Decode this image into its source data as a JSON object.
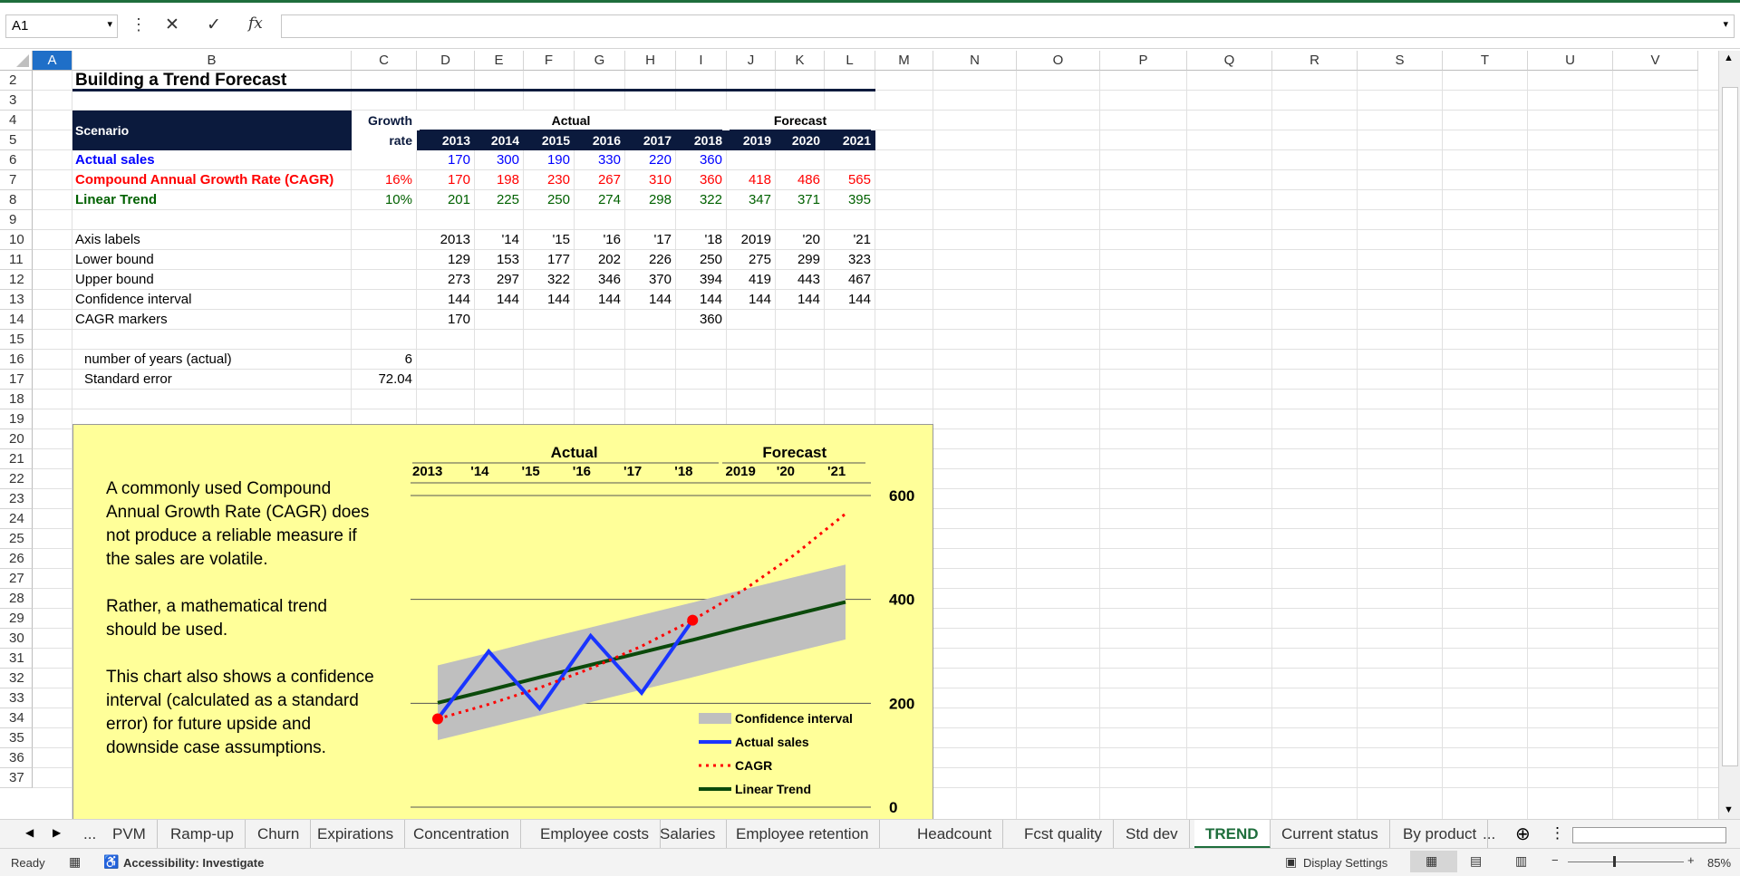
{
  "formula_bar": {
    "name_box": "A1",
    "formula": ""
  },
  "columns": [
    "A",
    "B",
    "C",
    "D",
    "E",
    "F",
    "G",
    "H",
    "I",
    "J",
    "K",
    "L",
    "M",
    "N",
    "O",
    "P",
    "Q",
    "R",
    "S",
    "T",
    "U",
    "V"
  ],
  "rows": [
    "2",
    "3",
    "4",
    "5",
    "6",
    "7",
    "8",
    "9",
    "10",
    "11",
    "12",
    "13",
    "14",
    "15",
    "16",
    "17",
    "18",
    "19",
    "20",
    "21",
    "22",
    "23",
    "24",
    "25",
    "26",
    "27",
    "28",
    "29",
    "30",
    "31",
    "32",
    "33",
    "34",
    "35",
    "36",
    "37"
  ],
  "sheet": {
    "title": "Building a Trend Forecast",
    "header": {
      "scenario": "Scenario",
      "growth_rate_1": "Growth",
      "growth_rate_2": "rate",
      "actual": "Actual",
      "forecast": "Forecast",
      "years": [
        "2013",
        "2014",
        "2015",
        "2016",
        "2017",
        "2018",
        "2019",
        "2020",
        "2021"
      ]
    },
    "actual_sales": {
      "label": "Actual sales",
      "rate": "",
      "values": [
        "170",
        "300",
        "190",
        "330",
        "220",
        "360",
        "",
        "",
        ""
      ]
    },
    "cagr": {
      "label": "Compound Annual Growth Rate (CAGR)",
      "rate": "16%",
      "values": [
        "170",
        "198",
        "230",
        "267",
        "310",
        "360",
        "418",
        "486",
        "565"
      ]
    },
    "linear": {
      "label": "Linear Trend",
      "rate": "10%",
      "values": [
        "201",
        "225",
        "250",
        "274",
        "298",
        "322",
        "347",
        "371",
        "395"
      ]
    },
    "axis_labels": {
      "label": "Axis labels",
      "values": [
        "2013",
        "'14",
        "'15",
        "'16",
        "'17",
        "'18",
        "2019",
        "'20",
        "'21"
      ]
    },
    "lower_bound": {
      "label": "Lower bound",
      "values": [
        "129",
        "153",
        "177",
        "202",
        "226",
        "250",
        "275",
        "299",
        "323"
      ]
    },
    "upper_bound": {
      "label": "Upper bound",
      "values": [
        "273",
        "297",
        "322",
        "346",
        "370",
        "394",
        "419",
        "443",
        "467"
      ]
    },
    "conf_interval": {
      "label": "Confidence interval",
      "values": [
        "144",
        "144",
        "144",
        "144",
        "144",
        "144",
        "144",
        "144",
        "144"
      ]
    },
    "cagr_markers": {
      "label": "CAGR markers",
      "values": [
        "170",
        "",
        "",
        "",
        "",
        "360",
        "",
        "",
        ""
      ]
    },
    "num_years": {
      "label": "number of years (actual)",
      "value": "6"
    },
    "std_error": {
      "label": "Standard error",
      "value": "72.04"
    }
  },
  "chart_text": [
    "A commonly used Compound Annual Growth Rate (CAGR) does not produce a reliable measure if the sales are volatile.",
    "Rather, a mathematical trend should be used.",
    "This chart also shows a confidence interval (calculated as a standard error) for future upside and downside case assumptions."
  ],
  "chart_data": {
    "type": "line",
    "categories": [
      "2013",
      "'14",
      "'15",
      "'16",
      "'17",
      "'18",
      "2019",
      "'20",
      "'21"
    ],
    "group_labels": {
      "actual": "Actual",
      "forecast": "Forecast"
    },
    "series": [
      {
        "name": "Confidence interval",
        "type": "band",
        "lower": [
          129,
          153,
          177,
          202,
          226,
          250,
          275,
          299,
          323
        ],
        "upper": [
          273,
          297,
          322,
          346,
          370,
          394,
          419,
          443,
          467
        ],
        "color": "#bfbfbf"
      },
      {
        "name": "Actual sales",
        "values": [
          170,
          300,
          190,
          330,
          220,
          360,
          null,
          null,
          null
        ],
        "color": "#1a35ff"
      },
      {
        "name": "CAGR",
        "values": [
          170,
          198,
          230,
          267,
          310,
          360,
          418,
          486,
          565
        ],
        "color": "#ff0000",
        "dash": true
      },
      {
        "name": "Linear Trend",
        "values": [
          201,
          225,
          250,
          274,
          298,
          322,
          347,
          371,
          395
        ],
        "color": "#0b4a0b"
      }
    ],
    "markers": [
      {
        "x": "2013",
        "y": 170
      },
      {
        "x": "'18",
        "y": 360
      }
    ],
    "y_ticks": [
      "0",
      "200",
      "400",
      "600"
    ],
    "ylim": [
      0,
      600
    ],
    "legend": "bottom-right",
    "grid": true
  },
  "tabs": [
    "...",
    "PVM",
    "Ramp-up",
    "Churn",
    "Expirations",
    "Concentration",
    "Employee costs",
    "Salaries",
    "Employee retention",
    "Headcount",
    "Fcst quality",
    "Std dev",
    "TREND",
    "Current status",
    "By product",
    "..."
  ],
  "active_tab": "TREND",
  "status": {
    "ready": "Ready",
    "accessibility": "Accessibility: Investigate",
    "display_settings": "Display Settings",
    "zoom": "85%"
  }
}
